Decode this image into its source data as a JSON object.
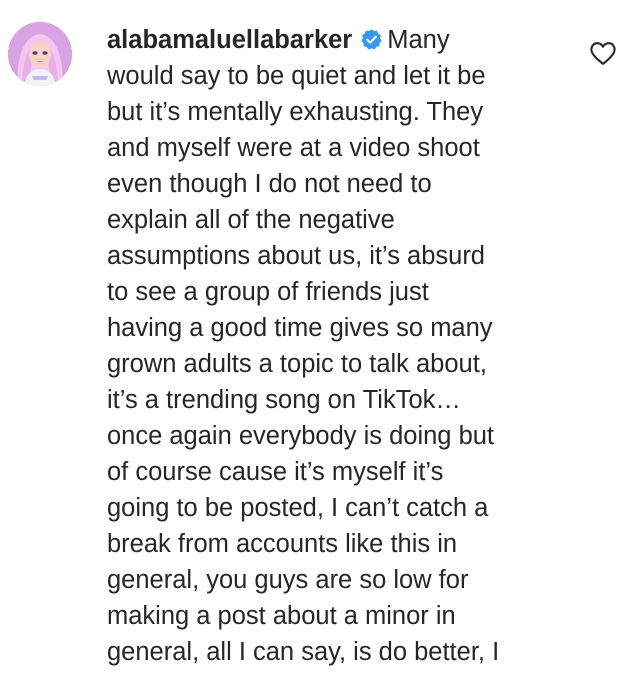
{
  "comment": {
    "username": "alabamaluellabarker",
    "verified": true,
    "first_line_text": "Many",
    "lines": [
      "would say to be quiet and let it be",
      "but it’s mentally exhausting. They",
      "and myself were at a video shoot",
      "even though I do not need to",
      "explain all of the negative",
      "assumptions about us, it’s absurd",
      "to see a group of friends just",
      "having a good time gives so many",
      "grown adults a topic to talk about,",
      "it’s a trending song on TikTok…",
      "once again everybody is doing but",
      "of course cause it’s myself it’s",
      "going to be posted, I can’t catch a",
      "break from accounts like this in",
      "general, you guys are so low for",
      "making a post about a minor in",
      "general, all I can say, is do better, I"
    ],
    "avatar_icon": "profile-avatar",
    "like_icon": "heart-outline-icon"
  },
  "colors": {
    "text": "#262626",
    "verified_badge": "#3897f0",
    "background": "#ffffff"
  }
}
